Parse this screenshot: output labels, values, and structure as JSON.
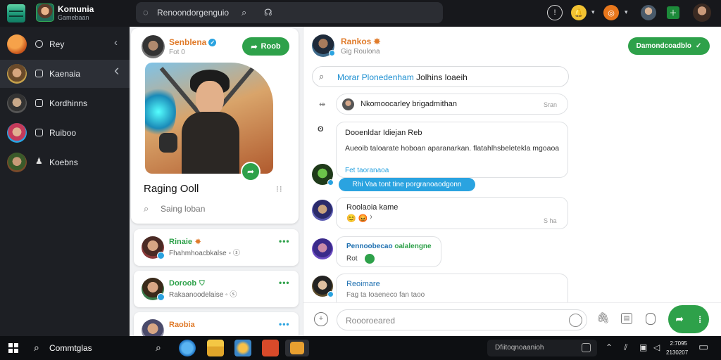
{
  "app": {
    "title": "Komunia",
    "subtitle": "Gamebaan",
    "search_placeholder": "Renoondorgenguio"
  },
  "sidebar": {
    "items": [
      {
        "label": "Rey"
      },
      {
        "label": "Kaenaia"
      },
      {
        "label": "Kordhinns"
      },
      {
        "label": "Ruiboo"
      },
      {
        "label": "Koebns"
      }
    ]
  },
  "profile": {
    "name": "Senblena",
    "sub": "Fot 0",
    "action_label": "Roob",
    "game_title": "Raging Ooll",
    "search_text": "Saing loban"
  },
  "friends": [
    {
      "name": "Rinaie",
      "sub": "Fhahmhoacbkalse"
    },
    {
      "name": "Doroob",
      "sub": "Rakaanoodelaise"
    },
    {
      "name": "Raobia",
      "sub": ""
    }
  ],
  "chat": {
    "contact_name": "Rankos",
    "contact_status": "Gig Roulona",
    "action_label": "Damondcoadblo",
    "search_text_highlight": "Morar Plonedenham",
    "search_text_rest": "Jolhins loaeih",
    "messages": [
      {
        "title": "Nkomoocarley brigadmithan",
        "time": "Sran"
      },
      {
        "title": "Dooenldar Idiejan Reb",
        "body": "Aueoib taloarate hoboan aparanarkan. flatahlhsbeletekla mgoaoa",
        "link": "Fet taoranaoa"
      },
      {
        "pill": "Rhi Vaa tont tine porgranoaodgonn"
      },
      {
        "title": "Roolaoia kame",
        "time": "S ha"
      },
      {
        "title": "Pennoobecao",
        "title_green": "oalalengne",
        "sub": "Rot"
      },
      {
        "title": "Reoimare",
        "sub": "Fag ta Ioaeneco fan taoo"
      }
    ],
    "input_placeholder": "Roooroeared"
  },
  "taskbar": {
    "search_label": "Commtglas",
    "notif_text": "Dfiitoqnoaanioh",
    "clock_time": "2:7095",
    "clock_date": "2130207"
  },
  "colors": {
    "accent_green": "#2ea14a",
    "accent_orange": "#e07b2a",
    "accent_blue": "#2aa3e0",
    "dark_bg": "#1d1f24"
  }
}
